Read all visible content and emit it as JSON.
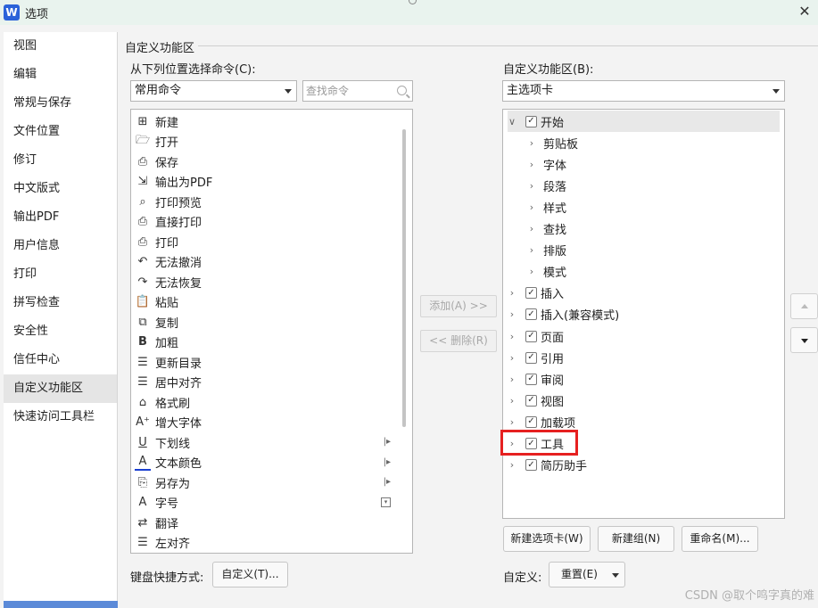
{
  "window": {
    "title": "选项",
    "app_badge": "W"
  },
  "sidebar": {
    "items": [
      {
        "label": "视图"
      },
      {
        "label": "编辑"
      },
      {
        "label": "常规与保存"
      },
      {
        "label": "文件位置"
      },
      {
        "label": "修订"
      },
      {
        "label": "中文版式"
      },
      {
        "label": "输出PDF"
      },
      {
        "label": "用户信息"
      },
      {
        "label": "打印"
      },
      {
        "label": "拼写检查"
      },
      {
        "label": "安全性"
      },
      {
        "label": "信任中心"
      },
      {
        "label": "自定义功能区",
        "active": true
      },
      {
        "label": "快速访问工具栏"
      }
    ]
  },
  "main": {
    "group_title": "自定义功能区",
    "left": {
      "label": "从下列位置选择命令(C):",
      "dropdown_value": "常用命令",
      "search_placeholder": "查找命令",
      "commands": [
        {
          "label": "新建",
          "icon": "new-doc-icon",
          "glyph": "⊞"
        },
        {
          "label": "打开",
          "icon": "folder-open-icon",
          "glyph": "🗁"
        },
        {
          "label": "保存",
          "icon": "save-icon",
          "glyph": "⎙"
        },
        {
          "label": "输出为PDF",
          "icon": "pdf-export-icon",
          "glyph": "⇲"
        },
        {
          "label": "打印预览",
          "icon": "print-preview-icon",
          "glyph": "⌕"
        },
        {
          "label": "直接打印",
          "icon": "direct-print-icon",
          "glyph": "⎙"
        },
        {
          "label": "打印",
          "icon": "printer-icon",
          "glyph": "⎙"
        },
        {
          "label": "无法撤消",
          "icon": "undo-icon",
          "glyph": "↶"
        },
        {
          "label": "无法恢复",
          "icon": "redo-icon",
          "glyph": "↷"
        },
        {
          "label": "粘贴",
          "icon": "paste-icon",
          "glyph": "📋"
        },
        {
          "label": "复制",
          "icon": "copy-icon",
          "glyph": "⧉"
        },
        {
          "label": "加粗",
          "icon": "bold-icon",
          "glyph": "B"
        },
        {
          "label": "更新目录",
          "icon": "update-toc-icon",
          "glyph": "☰"
        },
        {
          "label": "居中对齐",
          "icon": "align-center-icon",
          "glyph": "☰"
        },
        {
          "label": "格式刷",
          "icon": "format-painter-icon",
          "glyph": "⌂"
        },
        {
          "label": "增大字体",
          "icon": "font-grow-icon",
          "glyph": "A⁺"
        },
        {
          "label": "下划线",
          "icon": "underline-icon",
          "glyph": "U",
          "submenu": true
        },
        {
          "label": "文本颜色",
          "icon": "text-color-icon",
          "glyph": "A",
          "submenu": true
        },
        {
          "label": "另存为",
          "icon": "save-as-icon",
          "glyph": "⎘",
          "submenu": true
        },
        {
          "label": "字号",
          "icon": "font-size-icon",
          "glyph": "A",
          "dropdown": true
        },
        {
          "label": "翻译",
          "icon": "translate-icon",
          "glyph": "⇄"
        },
        {
          "label": "左对齐",
          "icon": "align-left-icon",
          "glyph": "☰"
        }
      ],
      "add_button": "添加(A) >>",
      "remove_button": "<< 删除(R)"
    },
    "right": {
      "label": "自定义功能区(B):",
      "dropdown_value": "主选项卡",
      "tree": [
        {
          "label": "开始",
          "level": 0,
          "expanded": true,
          "checked": true
        },
        {
          "label": "剪贴板",
          "level": 1
        },
        {
          "label": "字体",
          "level": 1
        },
        {
          "label": "段落",
          "level": 1
        },
        {
          "label": "样式",
          "level": 1
        },
        {
          "label": "查找",
          "level": 1
        },
        {
          "label": "排版",
          "level": 1
        },
        {
          "label": "模式",
          "level": 1
        },
        {
          "label": "插入",
          "level": 0,
          "checked": true
        },
        {
          "label": "插入(兼容模式)",
          "level": 0,
          "checked": true
        },
        {
          "label": "页面",
          "level": 0,
          "checked": true
        },
        {
          "label": "引用",
          "level": 0,
          "checked": true
        },
        {
          "label": "审阅",
          "level": 0,
          "checked": true
        },
        {
          "label": "视图",
          "level": 0,
          "checked": true
        },
        {
          "label": "加载项",
          "level": 0,
          "checked": true
        },
        {
          "label": "工具",
          "level": 0,
          "checked": true,
          "highlighted": true
        },
        {
          "label": "简历助手",
          "level": 0,
          "checked": true
        }
      ],
      "buttons": {
        "new_tab": "新建选项卡(W)",
        "new_group": "新建组(N)",
        "rename": "重命名(M)..."
      },
      "customize_label": "自定义:",
      "reset_button": "重置(E)"
    },
    "keyboard_label": "键盘快捷方式:",
    "keyboard_button": "自定义(T)..."
  },
  "watermark": "CSDN @取个鸣字真的难",
  "colors": {
    "highlight": "#e62020",
    "titlebar": "#e9f3ee",
    "app_badge": "#2b62d9"
  }
}
